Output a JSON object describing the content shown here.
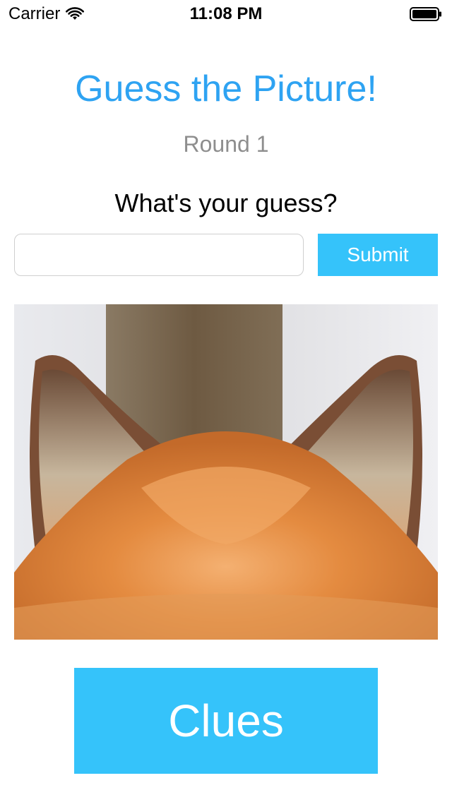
{
  "status_bar": {
    "carrier": "Carrier",
    "time": "11:08 PM",
    "wifi_icon": "wifi-icon",
    "battery_icon": "battery-icon"
  },
  "header": {
    "title": "Guess the Picture!",
    "round": "Round 1"
  },
  "guess": {
    "prompt": "What's your guess?",
    "input_value": "",
    "input_placeholder": "",
    "submit_label": "Submit"
  },
  "picture": {
    "subject": "fox ears close-up"
  },
  "clues_label": "Clues",
  "colors": {
    "title": "#2ea3f2",
    "button": "#35c3fa",
    "round_text": "#8e8e8e"
  }
}
